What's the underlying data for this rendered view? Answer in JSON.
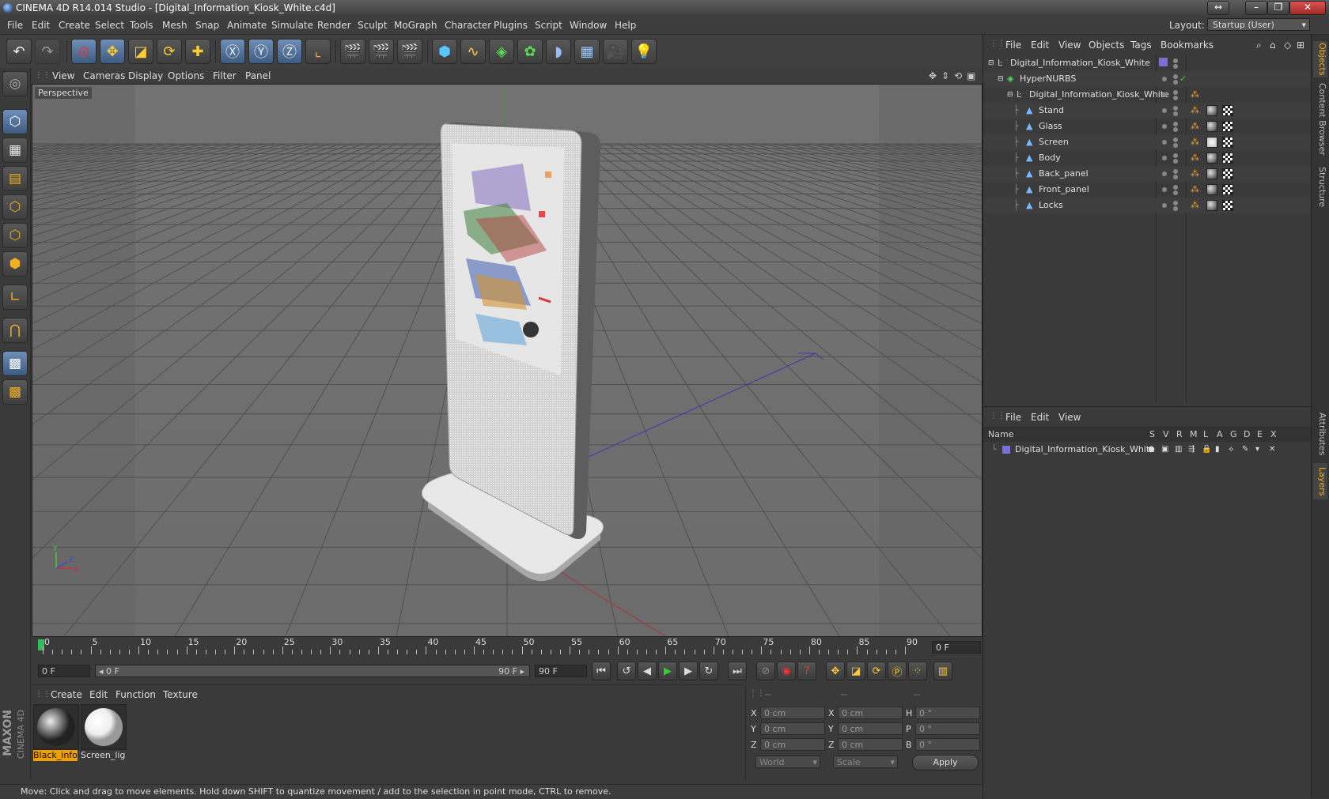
{
  "window": {
    "title": "CINEMA 4D R14.014 Studio - [Digital_Information_Kiosk_White.c4d]",
    "controls": [
      "↔",
      "–",
      "❐",
      "✕"
    ]
  },
  "menubar": {
    "items": [
      "File",
      "Edit",
      "Create",
      "Select",
      "Tools",
      "Mesh",
      "Snap",
      "Animate",
      "Simulate",
      "Render",
      "Sculpt",
      "MoGraph",
      "Character",
      "Plugins",
      "Script",
      "Window",
      "Help"
    ],
    "layout_label": "Layout:",
    "layout_value": "Startup (User)"
  },
  "viewport": {
    "menu": [
      "View",
      "Cameras",
      "Display",
      "Options",
      "Filter",
      "Panel"
    ],
    "camera_label": "Perspective",
    "axis_labels": {
      "y": "Y",
      "x": "X",
      "z": "Z"
    }
  },
  "timeline": {
    "ticks": [
      "0",
      "5",
      "10",
      "15",
      "20",
      "25",
      "30",
      "35",
      "40",
      "45",
      "50",
      "55",
      "60",
      "65",
      "70",
      "75",
      "80",
      "85",
      "90"
    ],
    "current_frame": "0 F",
    "start_field": "0 F",
    "range_start": "◂ 0 F",
    "range_end": "90 F ▸",
    "end_field": "90 F"
  },
  "materials": {
    "menu": [
      "Create",
      "Edit",
      "Function",
      "Texture"
    ],
    "items": [
      {
        "name": "Black_infor",
        "selected": true
      },
      {
        "name": "Screen_ligh",
        "selected": false
      }
    ]
  },
  "coordinates": {
    "headers": [
      "--",
      "--",
      "--"
    ],
    "rows": [
      {
        "l1": "X",
        "v1": "0 cm",
        "l2": "X",
        "v2": "0 cm",
        "l3": "H",
        "v3": "0 °"
      },
      {
        "l1": "Y",
        "v1": "0 cm",
        "l2": "Y",
        "v2": "0 cm",
        "l3": "P",
        "v3": "0 °"
      },
      {
        "l1": "Z",
        "v1": "0 cm",
        "l2": "Z",
        "v2": "0 cm",
        "l3": "B",
        "v3": "0 °"
      }
    ],
    "mode1": "World",
    "mode2": "Scale",
    "apply_label": "Apply"
  },
  "status": {
    "text": "Move: Click and drag to move elements. Hold down SHIFT to quantize movement / add to the selection in point mode, CTRL to remove."
  },
  "object_manager": {
    "menu": [
      "File",
      "Edit",
      "View",
      "Objects",
      "Tags",
      "Bookmarks"
    ],
    "objects": [
      {
        "name": "Digital_Information_Kiosk_White",
        "indent": 0,
        "icon": "null-icon"
      },
      {
        "name": "HyperNURBS",
        "indent": 1,
        "icon": "hypernurbs-icon"
      },
      {
        "name": "Digital_Information_Kiosk_White",
        "indent": 2,
        "icon": "null-icon"
      },
      {
        "name": "Stand",
        "indent": 3,
        "icon": "polygon-icon"
      },
      {
        "name": "Glass",
        "indent": 3,
        "icon": "polygon-icon"
      },
      {
        "name": "Screen",
        "indent": 3,
        "icon": "polygon-icon"
      },
      {
        "name": "Body",
        "indent": 3,
        "icon": "polygon-icon"
      },
      {
        "name": "Back_panel",
        "indent": 3,
        "icon": "polygon-icon"
      },
      {
        "name": "Front_panel",
        "indent": 3,
        "icon": "polygon-icon"
      },
      {
        "name": "Locks",
        "indent": 3,
        "icon": "polygon-icon"
      }
    ]
  },
  "layer_manager": {
    "menu": [
      "File",
      "Edit",
      "View"
    ],
    "name_header": "Name",
    "col_headers": [
      "S",
      "V",
      "R",
      "M",
      "L",
      "A",
      "G",
      "D",
      "E",
      "X"
    ],
    "layers": [
      {
        "name": "Digital_Information_Kiosk_White",
        "color": "#7a6fd8"
      }
    ]
  },
  "side_tabs": [
    "Objects",
    "Content Browser",
    "Structure",
    "Attributes",
    "Layers"
  ],
  "brand": {
    "maxon": "MAXON",
    "product": "CINEMA 4D"
  },
  "colors": {
    "accent": "#f0b020",
    "selection_blue": "#5a7aa8"
  }
}
